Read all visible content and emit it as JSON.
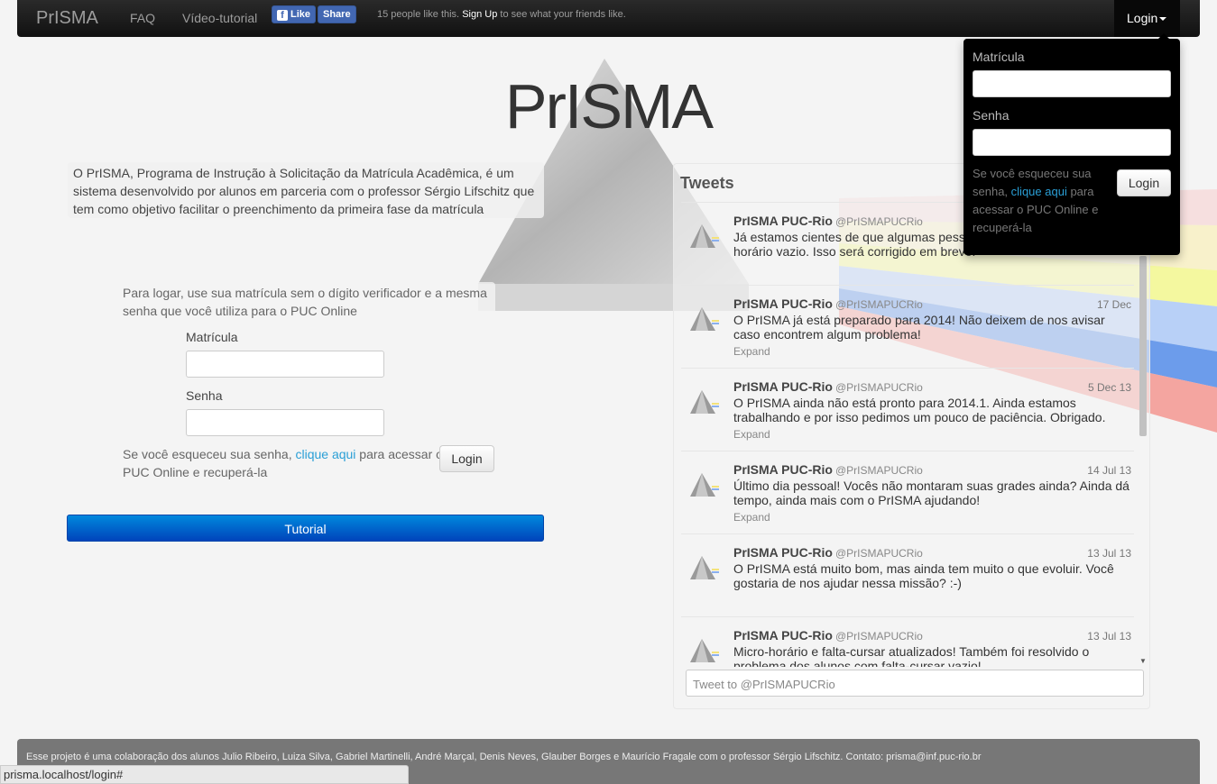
{
  "navbar": {
    "brand": "PrISMA",
    "links": [
      "FAQ",
      "Vídeo-tutorial"
    ],
    "fb_like": "Like",
    "fb_share": "Share",
    "fb_count_text": "15 people like this.",
    "fb_signup": "Sign Up",
    "fb_signup_suffix": "to see what your friends like.",
    "login_toggle": "Login"
  },
  "dropdown": {
    "matricula_label": "Matrícula",
    "senha_label": "Senha",
    "help_prefix": "Se você esqueceu sua senha,",
    "help_link": "clique aqui",
    "help_suffix": "para acessar o PUC Online e recuperá-la",
    "login_button": "Login"
  },
  "hero": {
    "title": "PrISMA",
    "about": "O PrISMA, Programa de Instrução à Solicitação da Matrícula Acadêmica, é um sistema desenvolvido por alunos em parceria com o professor Sérgio Lifschitz que tem como objetivo facilitar o preenchimento da primeira fase da matrícula"
  },
  "login_panel": {
    "instructions": "Para logar, use sua matrícula sem o dígito verificador e a mesma senha que você utiliza para o PUC Online",
    "matricula_label": "Matrícula",
    "senha_label": "Senha",
    "help_prefix": "Se você esqueceu sua senha,",
    "help_link": "clique aqui",
    "help_suffix": "para acessar o PUC Online e recuperá-la",
    "login_button": "Login",
    "tutorial_button": "Tutorial"
  },
  "tweets": {
    "title": "Tweets",
    "composer_placeholder": "Tweet to @PrISMAPUCRio",
    "items": [
      {
        "name": "PrISMA PUC-Rio",
        "handle": "@PrISMAPUCRio",
        "date": "",
        "text": "Já estamos cientes de que algumas pessoas estão recebendo o horário vazio. Isso será corrigido em breve.",
        "expand": ""
      },
      {
        "name": "PrISMA PUC-Rio",
        "handle": "@PrISMAPUCRio",
        "date": "17 Dec",
        "text": "O PrISMA já está preparado para 2014! Não deixem de nos avisar caso encontrem algum problema!",
        "expand": "Expand"
      },
      {
        "name": "PrISMA PUC-Rio",
        "handle": "@PrISMAPUCRio",
        "date": "5 Dec 13",
        "text": "O PrISMA ainda não está pronto para 2014.1. Ainda estamos trabalhando e por isso pedimos um pouco de paciência. Obrigado.",
        "expand": "Expand"
      },
      {
        "name": "PrISMA PUC-Rio",
        "handle": "@PrISMAPUCRio",
        "date": "14 Jul 13",
        "text": "Último dia pessoal! Vocês não montaram suas grades ainda? Ainda dá tempo, ainda mais com o PrISMA ajudando!",
        "expand": "Expand"
      },
      {
        "name": "PrISMA PUC-Rio",
        "handle": "@PrISMAPUCRio",
        "date": "13 Jul 13",
        "text": "O PrISMA está muito bom, mas ainda tem muito o que evoluir. Você gostaria de nos ajudar nessa missão? :-)",
        "expand": ""
      },
      {
        "name": "PrISMA PUC-Rio",
        "handle": "@PrISMAPUCRio",
        "date": "13 Jul 13",
        "text": "Micro-horário e falta-cursar atualizados! Também foi resolvido o problema dos alunos com falta-cursar vazio!",
        "expand": ""
      }
    ]
  },
  "footer": {
    "text": "Esse projeto é uma colaboração dos alunos Julio Ribeiro, Luiza Silva, Gabriel Martinelli, André Marçal, Denis Neves, Glauber Borges e Maurício Fragale com o professor Sérgio Lifschitz. Contato: prisma@inf.puc-rio.br"
  },
  "statusbar": {
    "url": "prisma.localhost/login#"
  },
  "colors": {
    "navbar": "#111111",
    "link": "#2a9fd6",
    "tutorial": "#0066cc",
    "fb": "#4267b2"
  }
}
